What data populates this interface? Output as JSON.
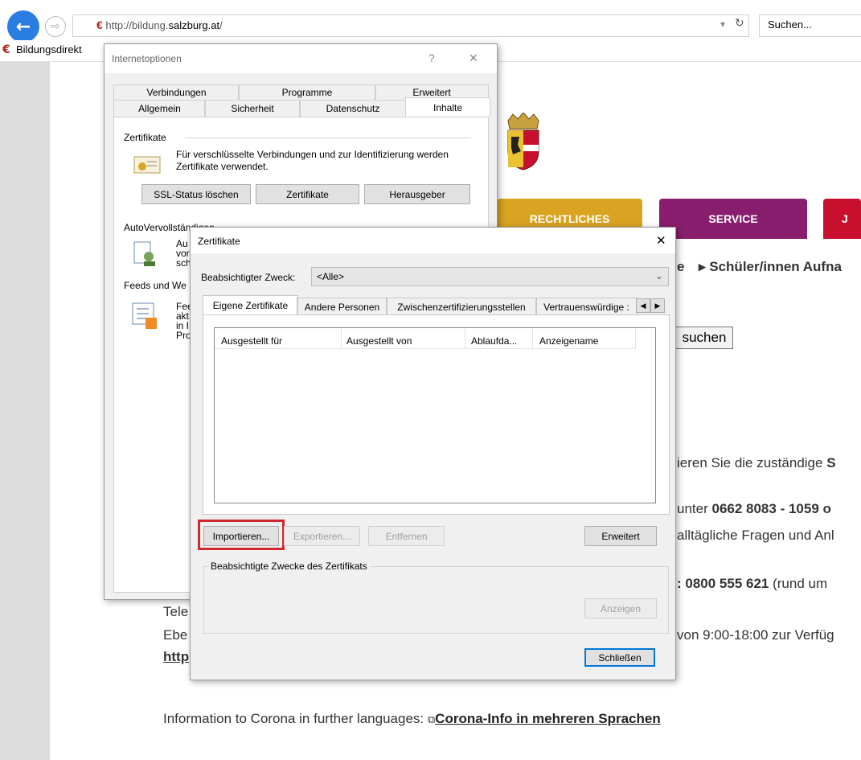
{
  "browser": {
    "url_prefix": "http://bildung.",
    "url_host": "salzburg.at",
    "url_suffix": "/",
    "search_placeholder": "Suchen...",
    "tab_title": "Bildungsdirekt",
    "back_icon": "back-arrow-icon",
    "forward_icon": "forward-arrow-icon"
  },
  "page": {
    "nav_tabs": [
      {
        "label": "RECHTLICHES",
        "color": "#d9a421"
      },
      {
        "label": "SERVICE",
        "color": "#8a1e6e"
      },
      {
        "label": "J",
        "color": "#c8102e"
      }
    ],
    "breadcrumb_end": "e",
    "breadcrumb_item": "▸ Schüler/innen Aufna",
    "search_button": "suchen",
    "line1": "ieren Sie die zuständige ",
    "line1_bold": "S",
    "line2_prefix": "unter ",
    "line2_bold": "0662 8083 - 1059 o",
    "line3": "alltägliche Fragen und Anl",
    "line4_bold": ": 0800 555 621",
    "line4_rest": " (rund um",
    "line5_left": "Tele",
    "line6_left": "Ebe",
    "line6_right": "von 9:00-18:00 zur Verfüg",
    "line7_left": "http",
    "bottom_text": "Information to Corona in further languages: ",
    "bottom_link": "Corona-Info in mehreren Sprachen"
  },
  "internet_options": {
    "title": "Internetoptionen",
    "help": "?",
    "close": "✕",
    "tabs_row1": [
      "Verbindungen",
      "Programme",
      "Erweitert"
    ],
    "tabs_row2": [
      "Allgemein",
      "Sicherheit",
      "Datenschutz",
      "Inhalte"
    ],
    "cert_group": "Zertifikate",
    "cert_desc": "Für verschlüsselte Verbindungen und zur Identifizierung werden Zertifikate verwendet.",
    "btn_ssl": "SSL-Status löschen",
    "btn_certs": "Zertifikate",
    "btn_publisher": "Herausgeber",
    "auto_group": "AutoVervollständigen",
    "auto_text": [
      "Au",
      "vor",
      "sch"
    ],
    "feeds_group": "Feeds und We",
    "feeds_text": [
      "Fee",
      "akt",
      "in I",
      "Pro"
    ]
  },
  "certificates": {
    "title": "Zertifikate",
    "close": "✕",
    "purpose_label": "Beabsichtigter Zweck:",
    "purpose_value": "<Alle>",
    "tabs": [
      "Eigene Zertifikate",
      "Andere Personen",
      "Zwischenzertifizierungsstellen",
      "Vertrauenswürdige :"
    ],
    "columns": [
      "Ausgestellt für",
      "Ausgestellt von",
      "Ablaufda...",
      "Anzeigename"
    ],
    "btn_import": "Importieren...",
    "btn_export": "Exportieren...",
    "btn_remove": "Entfernen",
    "btn_advanced": "Erweitert",
    "purposes_group": "Beabsichtigte Zwecke des Zertifikats",
    "btn_view": "Anzeigen",
    "btn_close": "Schließen",
    "highlight_color": "#d0282e"
  }
}
